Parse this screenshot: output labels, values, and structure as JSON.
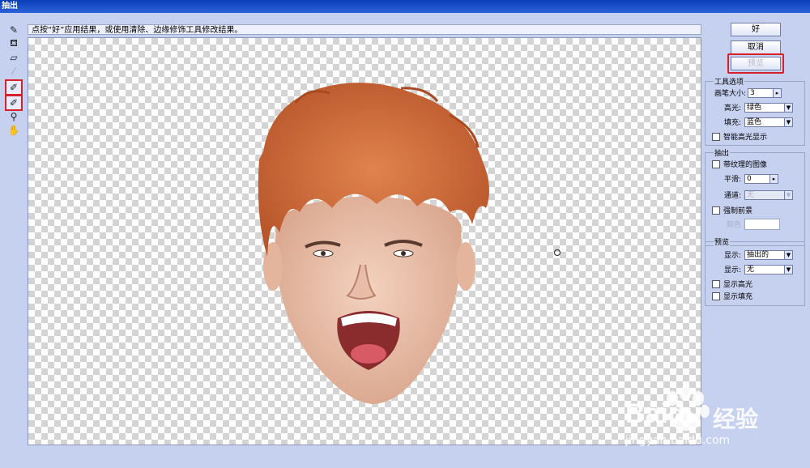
{
  "window": {
    "title": "抽出"
  },
  "hint": "点按“好”应用结果，或使用清除、边缘修饰工具修改结果。",
  "tools": [
    {
      "name": "edge-highlighter-tool",
      "icon": "pen-icon",
      "glyph": "✎",
      "selected": false
    },
    {
      "name": "fill-tool",
      "icon": "bucket-icon",
      "glyph": "⛾",
      "selected": false
    },
    {
      "name": "eraser-tool",
      "icon": "eraser-icon",
      "glyph": "▱",
      "selected": false
    },
    {
      "name": "eyedropper-tool",
      "icon": "eyedropper-icon",
      "glyph": "⁄",
      "selected": false
    },
    {
      "name": "cleanup-tool",
      "icon": "cleanup-icon",
      "glyph": "✐",
      "selected": true
    },
    {
      "name": "edge-touchup-tool",
      "icon": "edge-touchup-icon",
      "glyph": "✐",
      "selected": true
    },
    {
      "name": "zoom-tool",
      "icon": "zoom-icon",
      "glyph": "⚲",
      "selected": false
    },
    {
      "name": "hand-tool",
      "icon": "hand-icon",
      "glyph": "✋",
      "selected": false
    }
  ],
  "buttons": {
    "ok": "好",
    "cancel": "取消",
    "preview": "预览"
  },
  "tool_options": {
    "title": "工具选项",
    "brush_size_label": "画笔大小:",
    "brush_size": "3",
    "highlight_label": "高光:",
    "highlight": "绿色",
    "fill_label": "填充:",
    "fill": "蓝色",
    "smart_highlight": "智能高光显示"
  },
  "extraction": {
    "title": "抽出",
    "textured_image": "带纹理的图像",
    "smooth_label": "平滑:",
    "smooth": "0",
    "channel_label": "通道:",
    "channel": "无",
    "force_foreground": "强制前景",
    "color_label": "颜色"
  },
  "preview": {
    "title": "预览",
    "show_label": "显示:",
    "show": "抽出的",
    "display_label": "显示:",
    "display": "无",
    "show_highlight": "显示高光",
    "show_fill": "显示填充"
  },
  "watermark": {
    "brand": "Baidu",
    "suffix": "经验",
    "url": "jingyan.baidu.com"
  }
}
